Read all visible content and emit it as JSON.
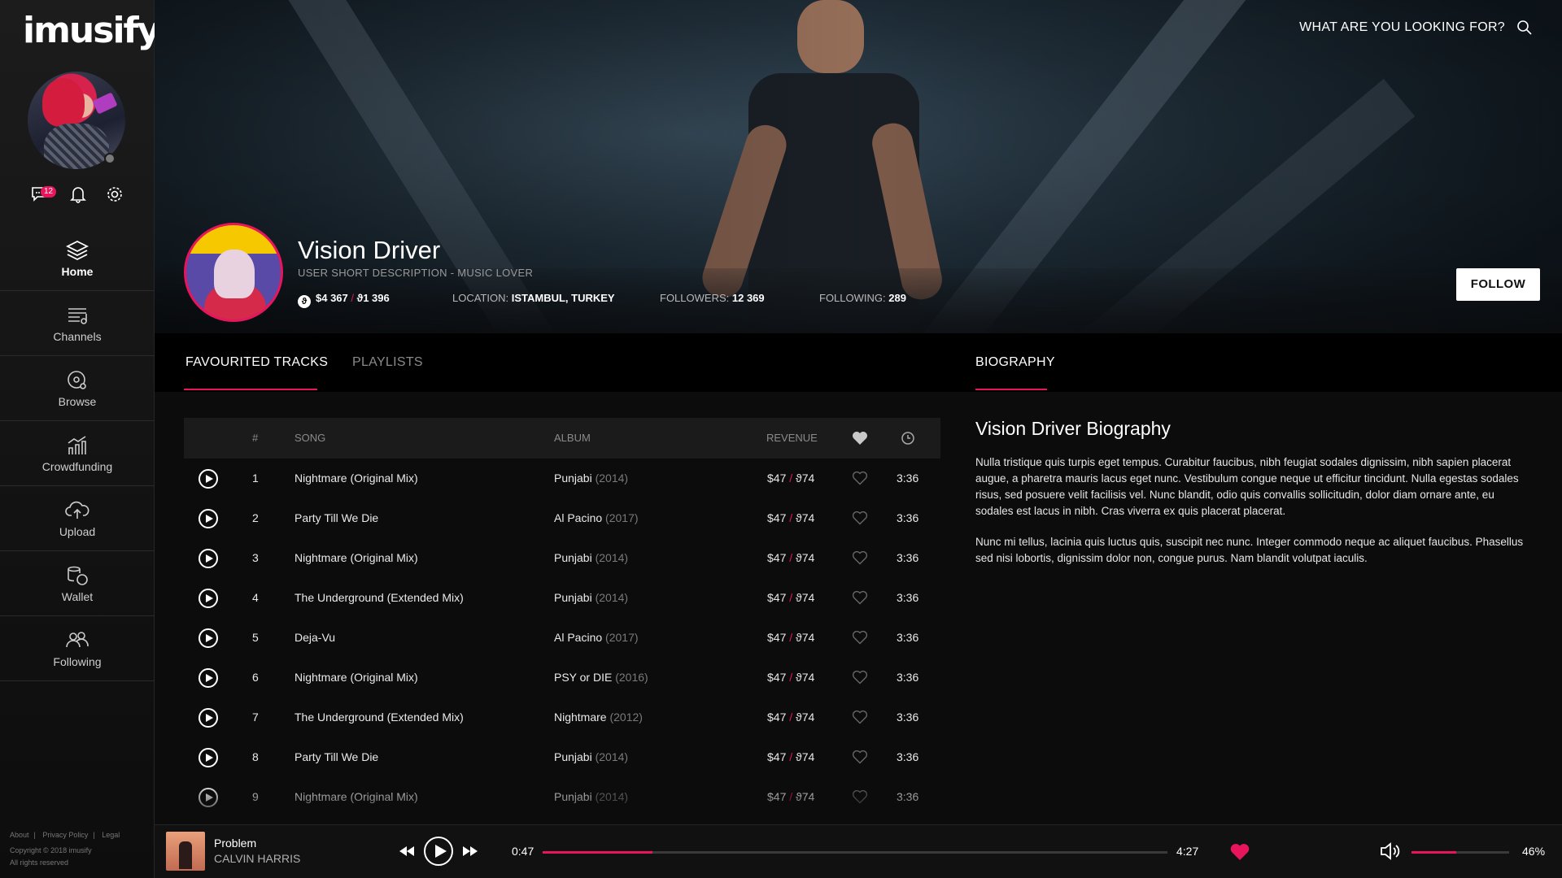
{
  "app": {
    "logo": "imusify."
  },
  "user": {
    "message_count": "12"
  },
  "nav": [
    {
      "label": "Home",
      "icon": "layers-icon",
      "active": true
    },
    {
      "label": "Channels",
      "icon": "channels-icon"
    },
    {
      "label": "Browse",
      "icon": "browse-icon"
    },
    {
      "label": "Crowdfunding",
      "icon": "chart-icon"
    },
    {
      "label": "Upload",
      "icon": "cloud-upload-icon"
    },
    {
      "label": "Wallet",
      "icon": "wallet-icon"
    },
    {
      "label": "Following",
      "icon": "users-icon"
    }
  ],
  "footer": {
    "about": "About",
    "privacy": "Privacy Policy",
    "legal": "Legal",
    "copyright": "Copyright © 2018 imusify",
    "rights": "All rights reserved"
  },
  "header": {
    "search_label": "WHAT ARE YOU LOOKING FOR?"
  },
  "artist": {
    "name": "Vision Driver",
    "description": "USER SHORT DESCRIPTION - MUSIC LOVER",
    "revenue_usd": "$4 367",
    "revenue_token": "ϑ1 396",
    "location_label": "LOCATION:",
    "location": "ISTAMBUL, TURKEY",
    "followers_label": "FOLLOWERS:",
    "followers": "12 369",
    "following_label": "FOLLOWING:",
    "following": "289",
    "follow_button": "FOLLOW"
  },
  "tabs": {
    "favourited": "FAVOURITED  TRACKS",
    "playlists": "PLAYLISTS",
    "biography": "BIOGRAPHY"
  },
  "table": {
    "headers": {
      "num": "#",
      "song": "SONG",
      "album": "ALBUM",
      "revenue": "REVENUE"
    },
    "rows": [
      {
        "num": "1",
        "song": "Nightmare (Original Mix)",
        "album": "Punjabi",
        "year": "(2014)",
        "usd": "$47",
        "token": "ϑ74",
        "time": "3:36"
      },
      {
        "num": "2",
        "song": "Party Till We Die",
        "album": "Al Pacino",
        "year": "(2017)",
        "usd": "$47",
        "token": "ϑ74",
        "time": "3:36"
      },
      {
        "num": "3",
        "song": "Nightmare (Original Mix)",
        "album": "Punjabi",
        "year": "(2014)",
        "usd": "$47",
        "token": "ϑ74",
        "time": "3:36"
      },
      {
        "num": "4",
        "song": "The Underground (Extended Mix)",
        "album": "Punjabi",
        "year": "(2014)",
        "usd": "$47",
        "token": "ϑ74",
        "time": "3:36"
      },
      {
        "num": "5",
        "song": "Deja-Vu",
        "album": "Al Pacino",
        "year": "(2017)",
        "usd": "$47",
        "token": "ϑ74",
        "time": "3:36"
      },
      {
        "num": "6",
        "song": "Nightmare (Original Mix)",
        "album": "PSY or DIE",
        "year": "(2016)",
        "usd": "$47",
        "token": "ϑ74",
        "time": "3:36"
      },
      {
        "num": "7",
        "song": "The Underground (Extended Mix)",
        "album": "Nightmare",
        "year": "(2012)",
        "usd": "$47",
        "token": "ϑ74",
        "time": "3:36"
      },
      {
        "num": "8",
        "song": "Party Till We Die",
        "album": "Punjabi",
        "year": "(2014)",
        "usd": "$47",
        "token": "ϑ74",
        "time": "3:36"
      },
      {
        "num": "9",
        "song": "Nightmare (Original Mix)",
        "album": "Punjabi",
        "year": "(2014)",
        "usd": "$47",
        "token": "ϑ74",
        "time": "3:36"
      }
    ]
  },
  "bio": {
    "title": "Vision Driver Biography",
    "p1": "Nulla tristique quis turpis eget tempus. Curabitur faucibus, nibh feugiat sodales dignissim, nibh sapien placerat augue, a pharetra mauris lacus eget nunc. Vestibulum congue neque ut efficitur tincidunt. Nulla egestas sodales risus, sed posuere velit facilisis vel. Nunc blandit, odio quis convallis sollicitudin, dolor diam ornare ante, eu sodales est lacus in nibh. Cras viverra ex quis placerat placerat.",
    "p2": "Nunc mi tellus, lacinia quis luctus quis, suscipit nec nunc. Integer commodo neque ac aliquet faucibus. Phasellus sed nisi lobortis, dignissim dolor non, congue purus. Nam blandit volutpat iaculis."
  },
  "player": {
    "song": "Problem",
    "artist": "CALVIN HARRIS",
    "elapsed": "0:47",
    "duration": "4:27",
    "progress": 0.176,
    "volume_label": "46%",
    "volume": 0.46,
    "liked": true
  },
  "colors": {
    "accent": "#e8145c",
    "background": "#0c0c0c",
    "sidebar": "#161616"
  }
}
